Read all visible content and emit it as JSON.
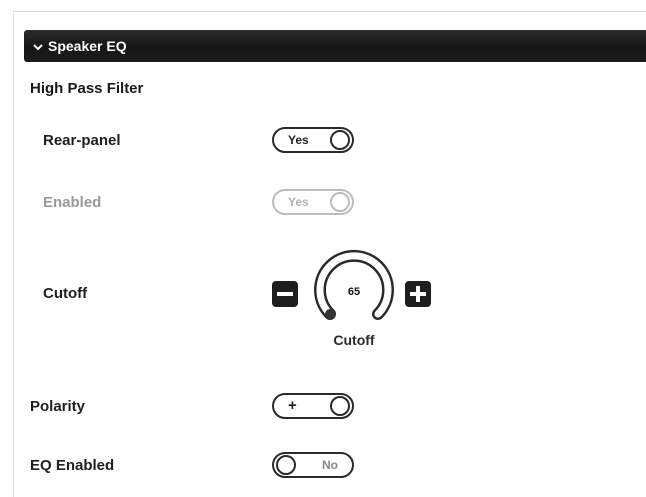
{
  "panel": {
    "header_title": "Speaker EQ",
    "section_title": "High Pass Filter"
  },
  "rows": {
    "rear_panel": {
      "label": "Rear-panel",
      "toggle_text": "Yes",
      "state": "on"
    },
    "enabled": {
      "label": "Enabled",
      "toggle_text": "Yes",
      "state": "on",
      "disabled": true
    },
    "cutoff": {
      "label": "Cutoff",
      "value": "65",
      "caption": "Cutoff"
    },
    "polarity": {
      "label": "Polarity",
      "toggle_text": "+",
      "state": "on"
    },
    "eq_enabled": {
      "label": "EQ Enabled",
      "toggle_text": "No",
      "state": "off"
    }
  },
  "icons": {
    "header_chevron": "chevron-down-icon",
    "decrement": "minus-icon",
    "increment": "plus-icon"
  },
  "colors": {
    "header_bg": "#1c1c1c",
    "text": "#1e1e1e",
    "disabled_text": "#9a9a9a"
  }
}
